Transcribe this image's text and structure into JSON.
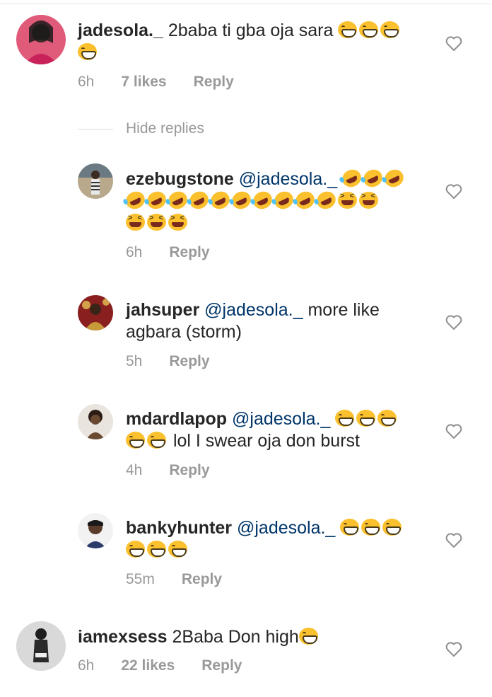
{
  "comments": [
    {
      "username": "jadesola._",
      "text": "2baba ti gba oja sara",
      "time": "6h",
      "likes": "7 likes",
      "reply": "Reply"
    },
    {
      "username": "ezebugstone",
      "mention": "@jadesola._",
      "time": "6h",
      "reply": "Reply"
    },
    {
      "username": "jahsuper",
      "mention": "@jadesola._",
      "text_line1": "more like",
      "text_line2": "agbara (storm)",
      "time": "5h",
      "reply": "Reply"
    },
    {
      "username": "mdardlapop",
      "mention": "@jadesola._",
      "text": "lol I swear oja don burst",
      "time": "4h",
      "reply": "Reply"
    },
    {
      "username": "bankyhunter",
      "mention": "@jadesola._",
      "time": "55m",
      "reply": "Reply"
    },
    {
      "username": "iamexsess",
      "text": "2Baba Don high",
      "time": "6h",
      "likes": "22 likes",
      "reply": "Reply"
    }
  ],
  "hide_replies": "Hide replies",
  "icons": {
    "like": "heart-outline-icon",
    "emoji_grin": "grinning-squinting-face",
    "emoji_rofl": "rolling-on-floor-laughing",
    "emoji_squint": "squinting-face-with-tongue"
  },
  "colors": {
    "text": "#262626",
    "meta": "#999999",
    "mention": "#003569",
    "emoji": "#fbc02d"
  }
}
